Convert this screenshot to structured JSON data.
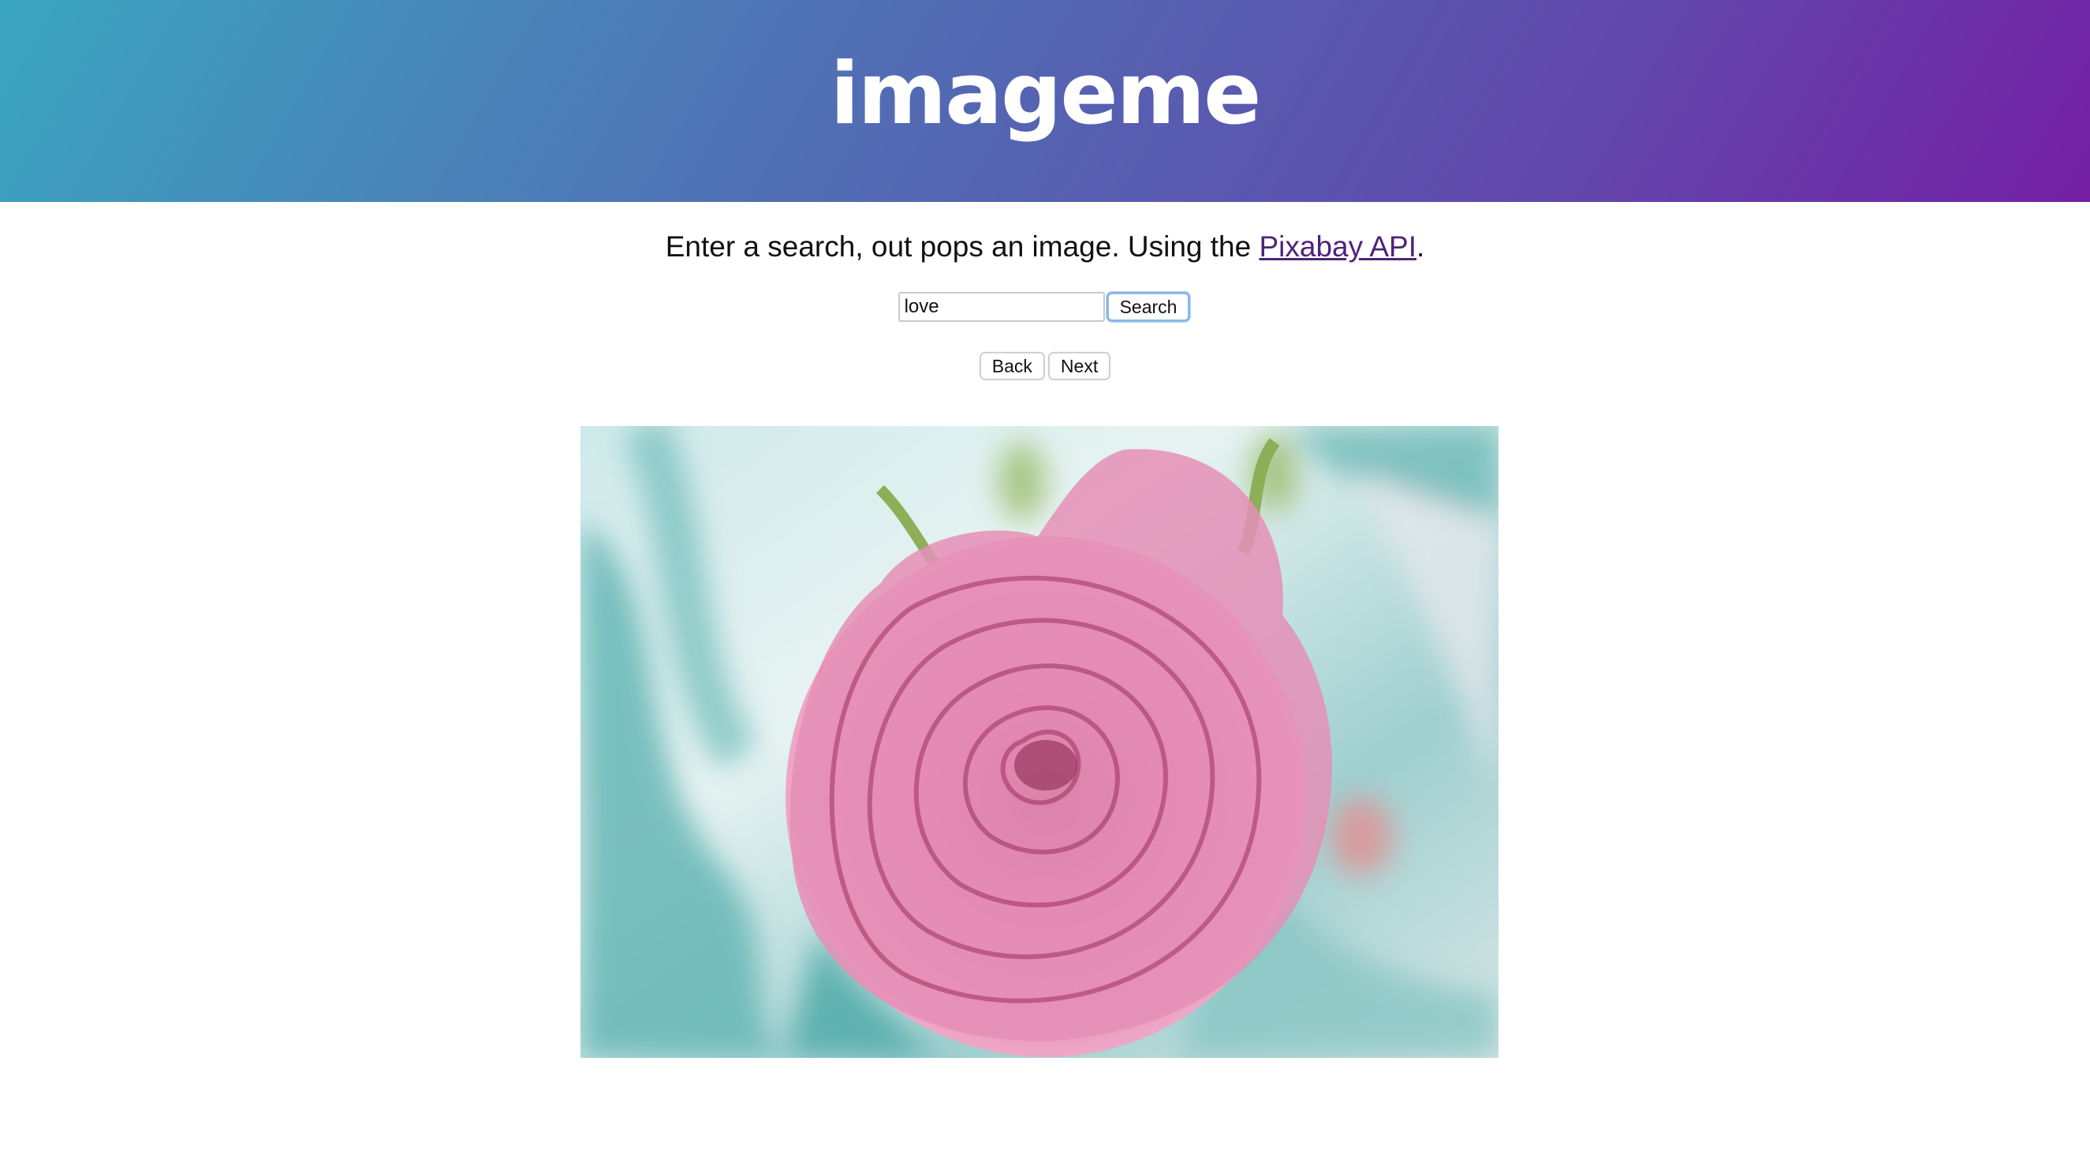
{
  "header": {
    "logo_text": "imageme",
    "gradient_start": "#3aa5c0",
    "gradient_end": "#741fa4"
  },
  "intro": {
    "text_before": "Enter a search, out pops an image. Using the ",
    "link_text": "Pixabay API",
    "text_after": ".",
    "link_color": "#4f2378"
  },
  "search": {
    "value": "love",
    "button_label": "Search"
  },
  "nav": {
    "back_label": "Back",
    "next_label": "Next"
  },
  "result": {
    "subject": "pink rose",
    "image_icon": "rose-photo"
  }
}
